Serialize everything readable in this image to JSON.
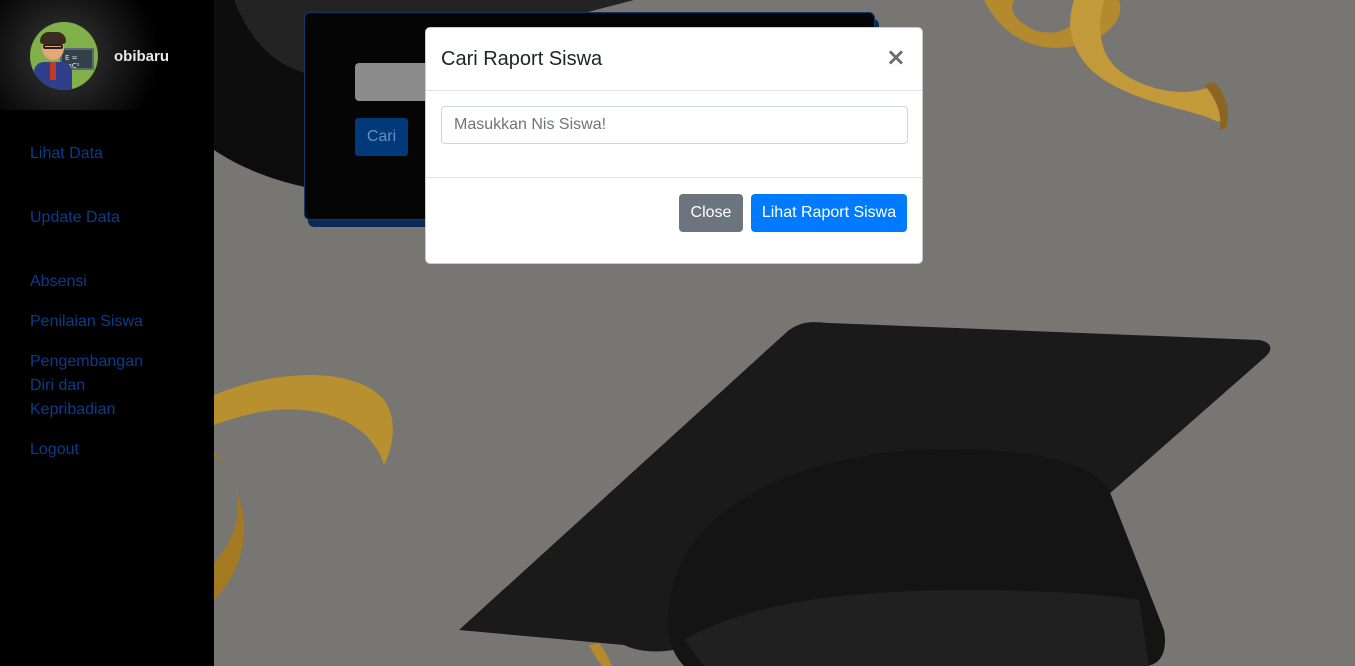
{
  "sidebar": {
    "username": "obibaru",
    "avatar_board_text": "E = mC²",
    "items": [
      {
        "label": "Lihat Data"
      },
      {
        "label": "Update Data"
      },
      {
        "label": "Absensi"
      },
      {
        "label": "Penilaian Siswa"
      },
      {
        "label": "Pengembangan Diri dan Kepribadian"
      },
      {
        "label": "Logout"
      }
    ],
    "link_color": "#0b3c8c"
  },
  "card": {
    "search_button_label": "Cari"
  },
  "modal": {
    "title": "Cari Raport Siswa",
    "close_icon": "×",
    "input": {
      "placeholder": "Masukkan Nis Siswa!",
      "value": ""
    },
    "close_button_label": "Close",
    "submit_button_label": "Lihat Raport Siswa"
  },
  "colors": {
    "primary": "#007bff",
    "secondary": "#6c757d",
    "backdrop": "#777673"
  }
}
